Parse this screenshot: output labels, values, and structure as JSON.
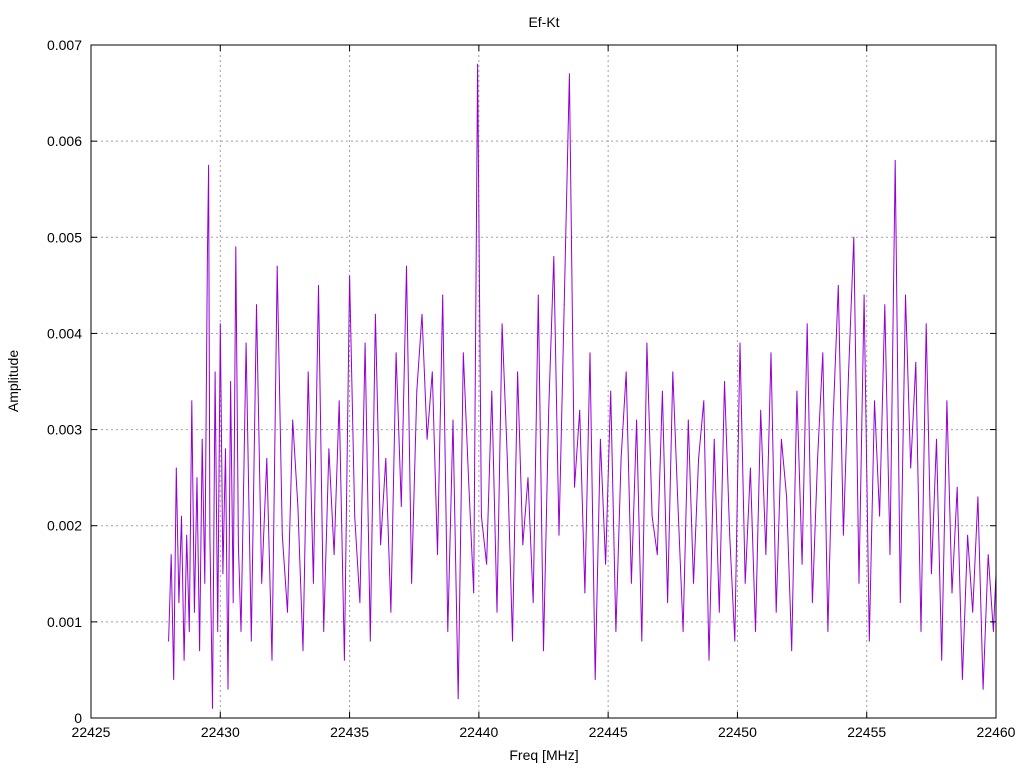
{
  "chart_data": {
    "type": "line",
    "title": "Ef-Kt",
    "xlabel": "Freq [MHz]",
    "ylabel": "Amplitude",
    "xlim": [
      22425,
      22460
    ],
    "ylim": [
      0,
      0.007
    ],
    "x_ticks": [
      {
        "value": 22425,
        "label": "22425"
      },
      {
        "value": 22430,
        "label": "22430"
      },
      {
        "value": 22435,
        "label": "22435"
      },
      {
        "value": 22440,
        "label": "22440"
      },
      {
        "value": 22445,
        "label": "22445"
      },
      {
        "value": 22450,
        "label": "22450"
      },
      {
        "value": 22455,
        "label": "22455"
      },
      {
        "value": 22460,
        "label": "22460"
      }
    ],
    "y_ticks": [
      {
        "value": 0,
        "label": "0"
      },
      {
        "value": 0.001,
        "label": "0.001"
      },
      {
        "value": 0.002,
        "label": "0.002"
      },
      {
        "value": 0.003,
        "label": "0.003"
      },
      {
        "value": 0.004,
        "label": "0.004"
      },
      {
        "value": 0.005,
        "label": "0.005"
      },
      {
        "value": 0.006,
        "label": "0.006"
      },
      {
        "value": 0.007,
        "label": "0.007"
      }
    ],
    "grid": true,
    "legend": "none",
    "line_color": "#9400d3",
    "series": [
      {
        "x": [
          22428.0,
          22428.1,
          22428.2,
          22428.3,
          22428.4,
          22428.5,
          22428.6,
          22428.7,
          22428.8,
          22428.9,
          22429.0,
          22429.1,
          22429.2,
          22429.3,
          22429.4,
          22429.5,
          22429.55,
          22429.6,
          22429.7,
          22429.8,
          22429.9,
          22430.0,
          22430.1,
          22430.2,
          22430.3,
          22430.4,
          22430.5,
          22430.6,
          22430.7,
          22430.8,
          22430.9,
          22431.0,
          22431.2,
          22431.4,
          22431.6,
          22431.8,
          22432.0,
          22432.2,
          22432.4,
          22432.6,
          22432.8,
          22433.0,
          22433.2,
          22433.4,
          22433.6,
          22433.8,
          22434.0,
          22434.2,
          22434.4,
          22434.6,
          22434.8,
          22435.0,
          22435.2,
          22435.4,
          22435.6,
          22435.8,
          22436.0,
          22436.2,
          22436.4,
          22436.6,
          22436.8,
          22437.0,
          22437.2,
          22437.4,
          22437.6,
          22437.8,
          22438.0,
          22438.2,
          22438.4,
          22438.6,
          22438.8,
          22439.0,
          22439.2,
          22439.4,
          22439.6,
          22439.8,
          22439.95,
          22440.1,
          22440.3,
          22440.5,
          22440.7,
          22440.9,
          22441.1,
          22441.3,
          22441.5,
          22441.7,
          22441.9,
          22442.1,
          22442.3,
          22442.5,
          22442.7,
          22442.9,
          22443.1,
          22443.3,
          22443.5,
          22443.7,
          22443.9,
          22444.1,
          22444.3,
          22444.5,
          22444.7,
          22444.9,
          22445.1,
          22445.3,
          22445.5,
          22445.7,
          22445.9,
          22446.1,
          22446.3,
          22446.5,
          22446.7,
          22446.9,
          22447.1,
          22447.3,
          22447.5,
          22447.7,
          22447.9,
          22448.1,
          22448.3,
          22448.5,
          22448.7,
          22448.9,
          22449.1,
          22449.3,
          22449.5,
          22449.7,
          22449.9,
          22450.1,
          22450.3,
          22450.5,
          22450.7,
          22450.9,
          22451.1,
          22451.3,
          22451.5,
          22451.7,
          22451.9,
          22452.1,
          22452.3,
          22452.5,
          22452.7,
          22452.9,
          22453.1,
          22453.3,
          22453.5,
          22453.7,
          22453.9,
          22454.1,
          22454.3,
          22454.5,
          22454.7,
          22454.9,
          22455.1,
          22455.3,
          22455.5,
          22455.7,
          22455.9,
          22456.1,
          22456.3,
          22456.5,
          22456.7,
          22456.9,
          22457.1,
          22457.3,
          22457.5,
          22457.7,
          22457.9,
          22458.1,
          22458.3,
          22458.5,
          22458.7,
          22458.9,
          22459.1,
          22459.3,
          22459.5,
          22459.7,
          22459.9,
          22460.0
        ],
        "y": [
          0.0008,
          0.0017,
          0.0004,
          0.0026,
          0.0012,
          0.0021,
          0.0006,
          0.0019,
          0.0009,
          0.0033,
          0.0011,
          0.0025,
          0.0007,
          0.0029,
          0.0014,
          0.0048,
          0.00575,
          0.0019,
          0.0001,
          0.0036,
          0.0009,
          0.0041,
          0.0015,
          0.0028,
          0.0003,
          0.0035,
          0.0012,
          0.0049,
          0.0018,
          0.0009,
          0.0024,
          0.0039,
          0.0008,
          0.0043,
          0.0014,
          0.0027,
          0.0006,
          0.0047,
          0.0019,
          0.0011,
          0.0031,
          0.0022,
          0.0007,
          0.0036,
          0.0014,
          0.0045,
          0.0009,
          0.0028,
          0.0017,
          0.0033,
          0.0006,
          0.0046,
          0.0021,
          0.0012,
          0.0039,
          0.0008,
          0.0042,
          0.0018,
          0.0027,
          0.0011,
          0.0038,
          0.0022,
          0.0047,
          0.0014,
          0.0034,
          0.0042,
          0.0029,
          0.0036,
          0.0017,
          0.0044,
          0.0009,
          0.0031,
          0.0002,
          0.0038,
          0.0025,
          0.0013,
          0.0068,
          0.0021,
          0.0016,
          0.0034,
          0.0011,
          0.0041,
          0.0027,
          0.0008,
          0.0036,
          0.0018,
          0.0025,
          0.0012,
          0.0044,
          0.0007,
          0.0032,
          0.0048,
          0.0019,
          0.0043,
          0.0067,
          0.0024,
          0.0032,
          0.0013,
          0.0038,
          0.0004,
          0.0029,
          0.0016,
          0.0034,
          0.0009,
          0.0027,
          0.0036,
          0.0014,
          0.0031,
          0.0008,
          0.0039,
          0.0021,
          0.0017,
          0.0034,
          0.0012,
          0.0036,
          0.0022,
          0.0009,
          0.0031,
          0.0014,
          0.0027,
          0.0033,
          0.0006,
          0.0029,
          0.0011,
          0.0035,
          0.0019,
          0.0008,
          0.0039,
          0.0014,
          0.0026,
          0.0009,
          0.0032,
          0.0017,
          0.0038,
          0.0011,
          0.0029,
          0.0023,
          0.0007,
          0.0034,
          0.0016,
          0.0041,
          0.0012,
          0.0027,
          0.0038,
          0.0009,
          0.0031,
          0.0045,
          0.0019,
          0.0036,
          0.005,
          0.0014,
          0.0044,
          0.0008,
          0.0033,
          0.0021,
          0.0043,
          0.0017,
          0.0058,
          0.0012,
          0.0044,
          0.0026,
          0.0037,
          0.0009,
          0.0041,
          0.0015,
          0.0029,
          0.0006,
          0.0033,
          0.0013,
          0.0024,
          0.0004,
          0.0019,
          0.0011,
          0.0023,
          0.0003,
          0.0017,
          0.0009,
          0.0015
        ]
      }
    ]
  }
}
